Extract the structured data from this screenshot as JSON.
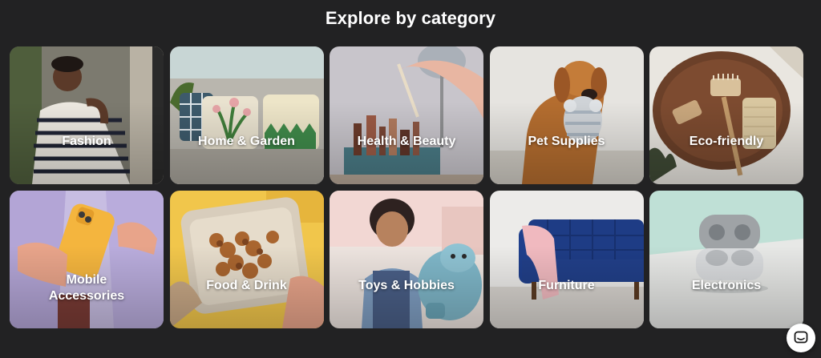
{
  "section": {
    "title": "Explore by category"
  },
  "categories": [
    {
      "label": "Fashion",
      "icon": "person-in-striped-sweater-photo"
    },
    {
      "label": "Home & Garden",
      "icon": "sofa-with-cushions-photo"
    },
    {
      "label": "Health & Beauty",
      "icon": "cosmetics-brushes-photo"
    },
    {
      "label": "Pet Supplies",
      "icon": "dog-with-toy-photo"
    },
    {
      "label": "Eco-friendly",
      "icon": "wooden-brushes-photo"
    },
    {
      "label": "Mobile\nAccessories",
      "icon": "yellow-phone-case-photo"
    },
    {
      "label": "Food & Drink",
      "icon": "skewers-tray-photo"
    },
    {
      "label": "Toys & Hobbies",
      "icon": "child-with-plush-toy-photo"
    },
    {
      "label": "Furniture",
      "icon": "blue-sofa-photo"
    },
    {
      "label": "Electronics",
      "icon": "wireless-earbuds-case-photo"
    }
  ],
  "chat": {
    "icon": "chat-bubble-icon"
  },
  "colors": {
    "background": "#222223",
    "text": "#ffffff"
  }
}
